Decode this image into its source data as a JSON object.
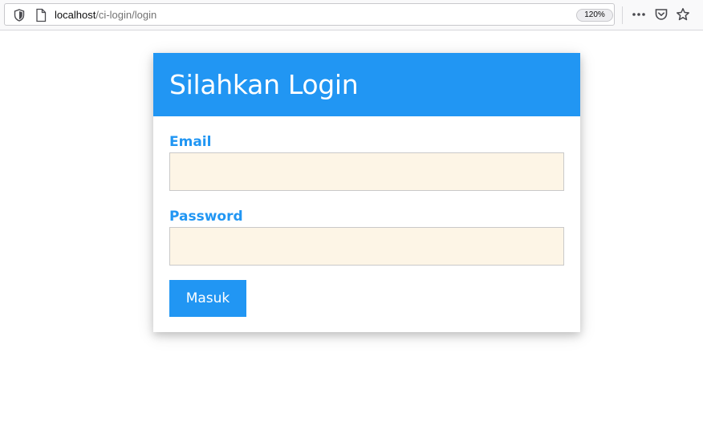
{
  "browser": {
    "url_host": "localhost",
    "url_path": "/ci-login/login",
    "zoom": "120%",
    "icons": {
      "shield": "shield-icon",
      "page": "page-icon",
      "more": "more-icon",
      "pocket": "pocket-icon",
      "bookmark": "star-icon"
    }
  },
  "login": {
    "title": "Silahkan Login",
    "email_label": "Email",
    "email_value": "",
    "password_label": "Password",
    "password_value": "",
    "submit_label": "Masuk"
  },
  "colors": {
    "accent": "#2196f3",
    "input_background": "#fdf5e6",
    "card_background": "#ffffff"
  }
}
